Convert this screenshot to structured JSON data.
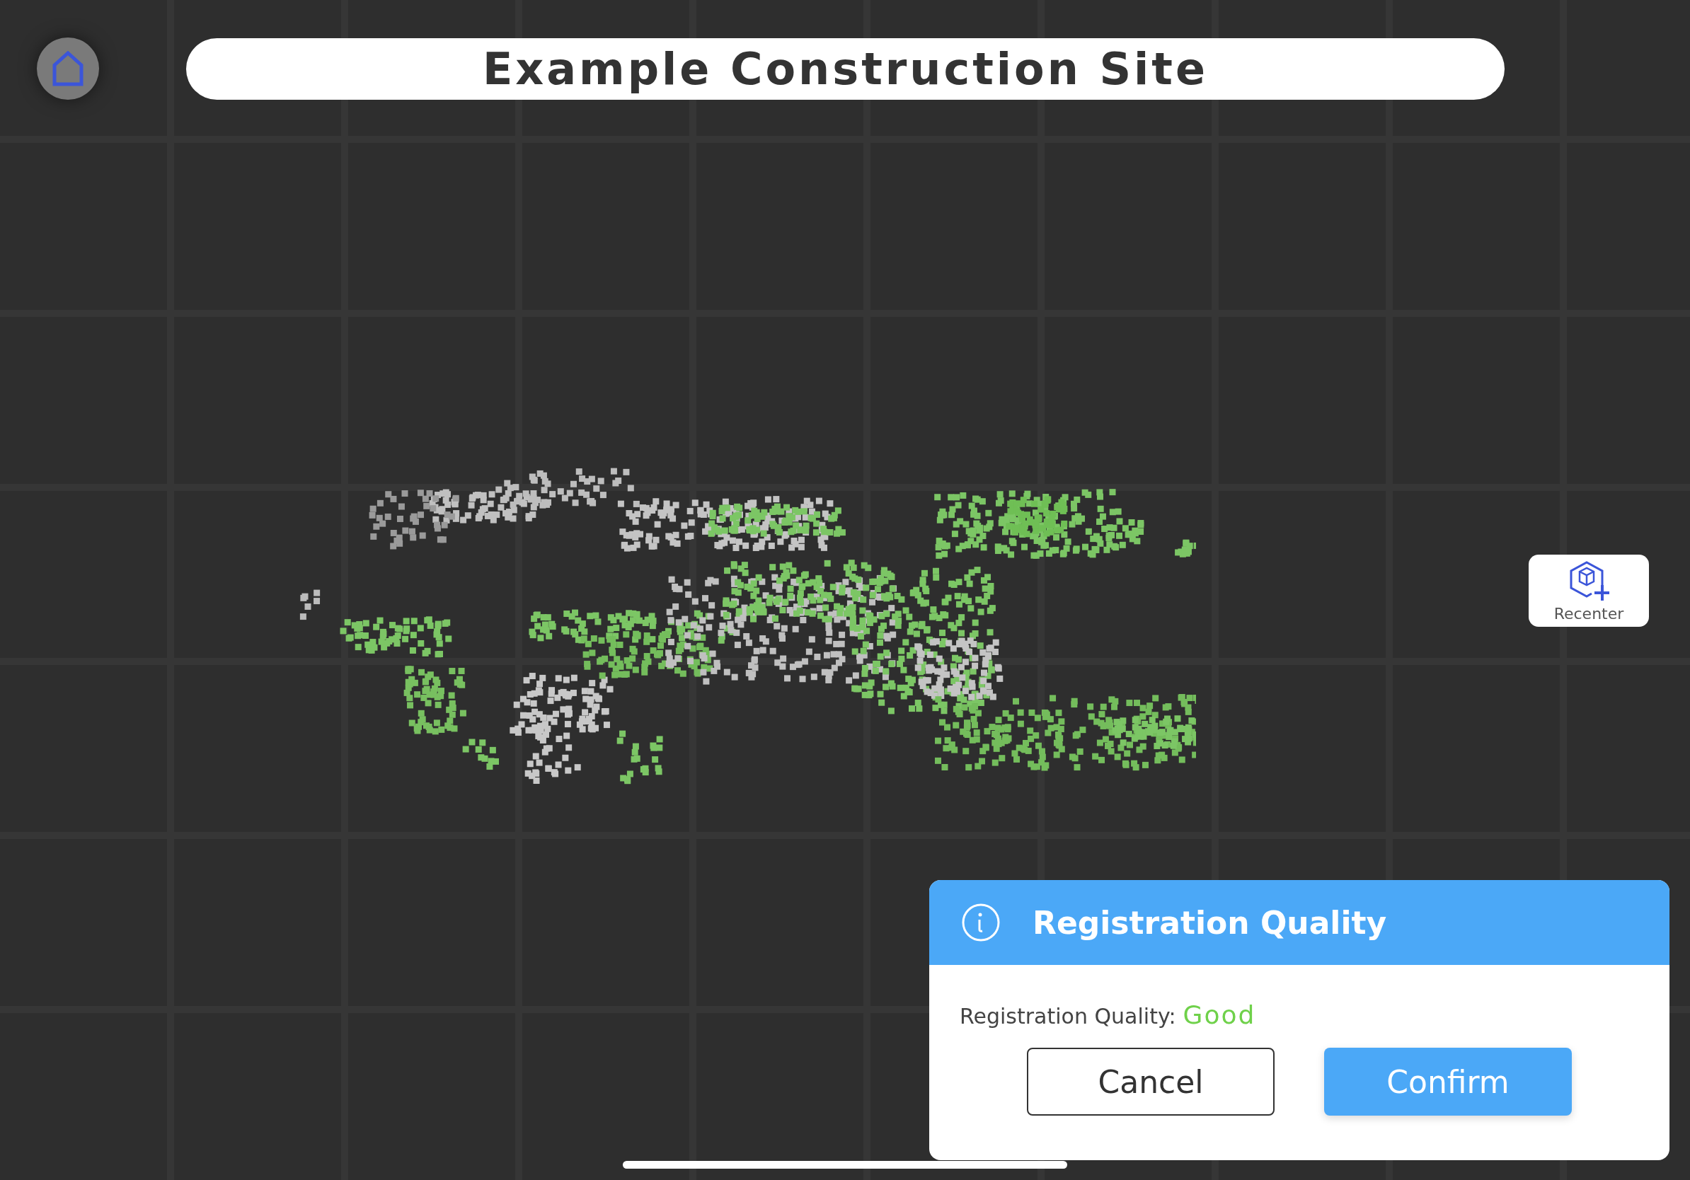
{
  "header": {
    "title": "Example Construction Site"
  },
  "recenter": {
    "label": "Recenter"
  },
  "dialog": {
    "title": "Registration Quality",
    "quality_label": "Registration Quality:",
    "quality_value": "Good",
    "buttons": [
      {
        "label": "Cancel",
        "kind": "secondary"
      },
      {
        "label": "Confirm",
        "kind": "primary"
      }
    ]
  }
}
